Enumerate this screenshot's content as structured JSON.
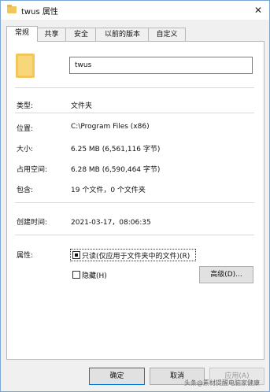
{
  "window": {
    "title": "twus 属性",
    "close": "✕"
  },
  "tabs": [
    {
      "label": "常规",
      "active": true
    },
    {
      "label": "共享"
    },
    {
      "label": "安全"
    },
    {
      "label": "以前的版本"
    },
    {
      "label": "自定义"
    }
  ],
  "general": {
    "name": "twus",
    "rows": [
      {
        "label": "类型:",
        "value": "文件夹"
      },
      {
        "label": "位置:",
        "value": "C:\\Program Files (x86)"
      },
      {
        "label": "大小:",
        "value": "6.25 MB (6,561,116 字节)"
      },
      {
        "label": "占用空间:",
        "value": "6.28 MB (6,590,464 字节)"
      },
      {
        "label": "包含:",
        "value": "19 个文件，0 个文件夹"
      },
      {
        "label": "创建时间:",
        "value": "2021-03-17，08:06:35"
      }
    ],
    "attributes_label": "属性:",
    "readonly_label": "只读(仅应用于文件夹中的文件)(R)",
    "hidden_label": "隐藏(H)",
    "advanced_label": "高级(D)..."
  },
  "buttons": {
    "ok": "确定",
    "cancel": "取消",
    "apply": "应用(A)"
  },
  "watermark": "头条@素材提醒电脑家健康"
}
